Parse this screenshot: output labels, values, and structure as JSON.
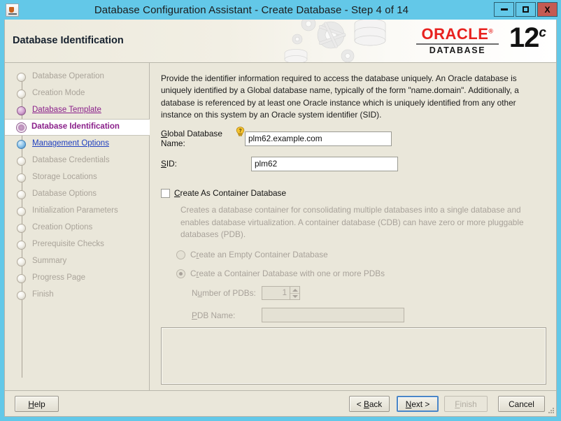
{
  "window": {
    "title": "Database Configuration Assistant - Create Database - Step 4 of 14",
    "app_icon": "java-app-icon",
    "minimize_label": "",
    "maximize_label": "",
    "close_label": "X",
    "colors": {
      "titlebar": "#63c8e8",
      "client_bg": "#eae7da",
      "close_button": "#c45b53",
      "accent_link": "#2040c0",
      "visited_link": "#8a1f8a",
      "oracle_red": "#e8221f"
    }
  },
  "banner": {
    "title": "Database Identification",
    "brand_word": "ORACLE",
    "brand_sub": "DATABASE",
    "version_number": "12",
    "version_suffix": "c"
  },
  "sidebar": {
    "items": [
      {
        "label": "Database Operation",
        "state": "pending"
      },
      {
        "label": "Creation Mode",
        "state": "pending"
      },
      {
        "label": "Database Template",
        "state": "visited"
      },
      {
        "label": "Database Identification",
        "state": "current"
      },
      {
        "label": "Management Options",
        "state": "link"
      },
      {
        "label": "Database Credentials",
        "state": "pending"
      },
      {
        "label": "Storage Locations",
        "state": "pending"
      },
      {
        "label": "Database Options",
        "state": "pending"
      },
      {
        "label": "Initialization Parameters",
        "state": "pending"
      },
      {
        "label": "Creation Options",
        "state": "pending"
      },
      {
        "label": "Prerequisite Checks",
        "state": "pending"
      },
      {
        "label": "Summary",
        "state": "pending"
      },
      {
        "label": "Progress Page",
        "state": "pending"
      },
      {
        "label": "Finish",
        "state": "pending"
      }
    ]
  },
  "main": {
    "intro": "Provide the identifier information required to access the database uniquely. An Oracle database is uniquely identified by a Global database name, typically of the form \"name.domain\". Additionally, a database is referenced by at least one Oracle instance which is uniquely identified from any other instance on this system by an Oracle system identifier (SID).",
    "global_db_name": {
      "label": "Global Database Name:",
      "label_mnemonic": "G",
      "value": "plm62.example.com",
      "help_icon": "help-bulb-icon"
    },
    "sid": {
      "label": "SID:",
      "label_mnemonic": "S",
      "value": "plm62"
    },
    "container_db": {
      "checkbox_label": "Create As Container Database",
      "checkbox_mnemonic": "C",
      "checked": false,
      "description": "Creates a database container for consolidating multiple databases into a single database and enables database virtualization. A container database (CDB) can have zero or more pluggable databases (PDB).",
      "options": [
        {
          "label": "Create an Empty Container Database",
          "mnemonic": "r",
          "selected": false
        },
        {
          "label": "Create a Container Database with one or more PDBs",
          "mnemonic": "r",
          "selected": true
        }
      ],
      "number_of_pdbs": {
        "label": "Number of PDBs:",
        "mnemonic": "u",
        "value": "1"
      },
      "pdb_name": {
        "label": "PDB Name:",
        "mnemonic": "P",
        "value": ""
      }
    },
    "message_panel": ""
  },
  "buttons": {
    "help": {
      "label": "Help",
      "mnemonic": "H",
      "enabled": true,
      "focused": false
    },
    "back": {
      "label": "< Back",
      "mnemonic": "B",
      "enabled": true,
      "focused": false
    },
    "next": {
      "label": "Next >",
      "mnemonic": "N",
      "enabled": true,
      "focused": true
    },
    "finish": {
      "label": "Finish",
      "mnemonic": "F",
      "enabled": false,
      "focused": false
    },
    "cancel": {
      "label": "Cancel",
      "mnemonic": "",
      "enabled": true,
      "focused": false
    }
  }
}
